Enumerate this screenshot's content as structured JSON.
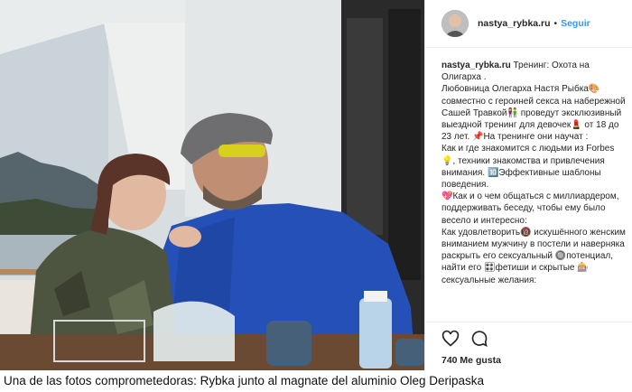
{
  "post": {
    "username": "nastya_rybka.ru",
    "separator": "•",
    "follow_label": "Seguir",
    "caption_lines": [
      "Тренинг: Охота на Олигарха .",
      "Любовница Олегарха Настя Рыбка🎨 совместно с героиней секса на набережной Сашей Травкой👫 проведут эксклюзивный выездной тренинг для девочек💄 от 18 до 23 лет. 📌На тренинге они научат :",
      "Как и где знакомится с людьми из Forbes💡, техники знакомства и привлечения внимания. 🔟Эффективные шаблоны поведения.",
      "💖Как и о чем общаться с миллиардером, поддерживать беседу, чтобы ему было весело и интересно:",
      "Как удовлетворить🔞 искушённого женским вниманием мужчину в постели и наверняка раскрыть его сексуальный 🔘потенциал, найти его 🎛фетиши и скрытые 🎰сексуальные желания:"
    ],
    "likes": "740 Me gusta",
    "icons": [
      "heart-icon",
      "comment-icon"
    ]
  },
  "image_caption": "Una de las fotos comprometedoras: Rybka junto al magnate del aluminio Oleg Deripaska"
}
